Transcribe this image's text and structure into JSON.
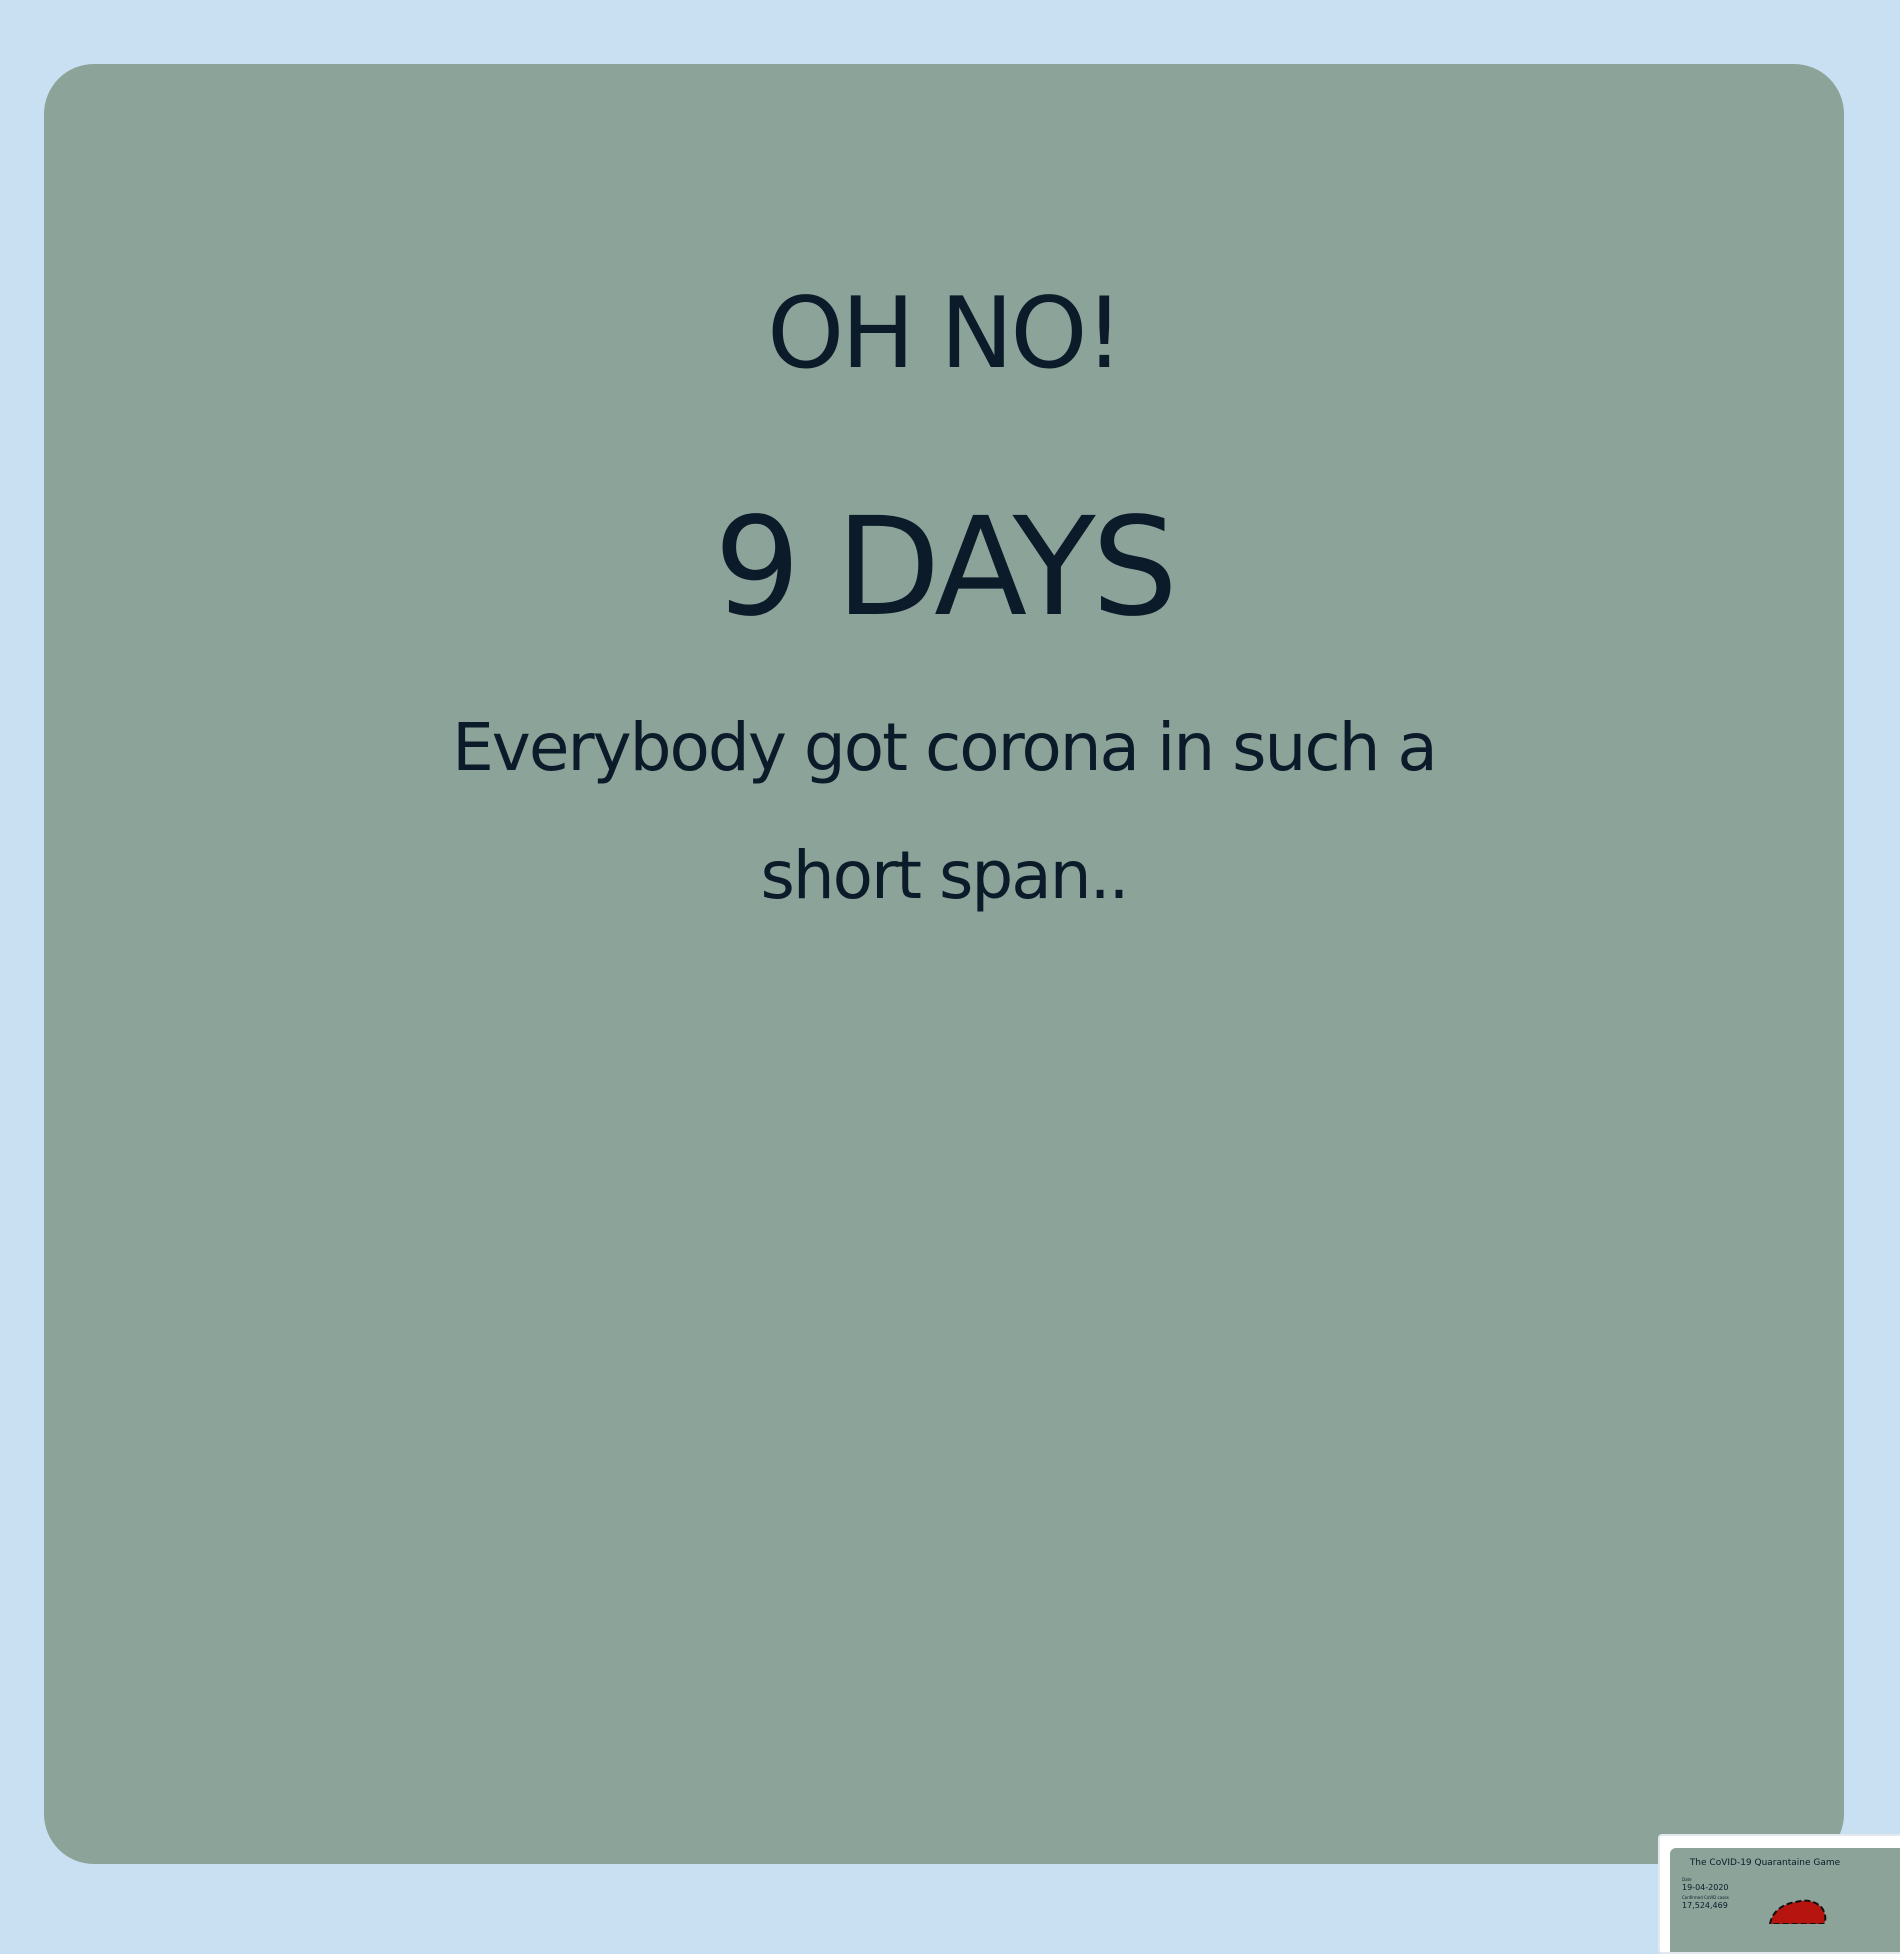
{
  "result": {
    "heading": "OH NO!",
    "days": "9 DAYS",
    "message": "Everybody got corona in such a short span.."
  },
  "preview": {
    "title": "The CoVID-19 Quarantaine Game",
    "date_label": "Date",
    "date_value": "19-04-2020",
    "cases_label": "Confirmed CoVID cases",
    "cases_value": "17,524,469"
  },
  "colors": {
    "background": "#c9dff2",
    "card": "#8ba398",
    "text": "#0c1b2a",
    "map_fill": "#b5140f"
  }
}
